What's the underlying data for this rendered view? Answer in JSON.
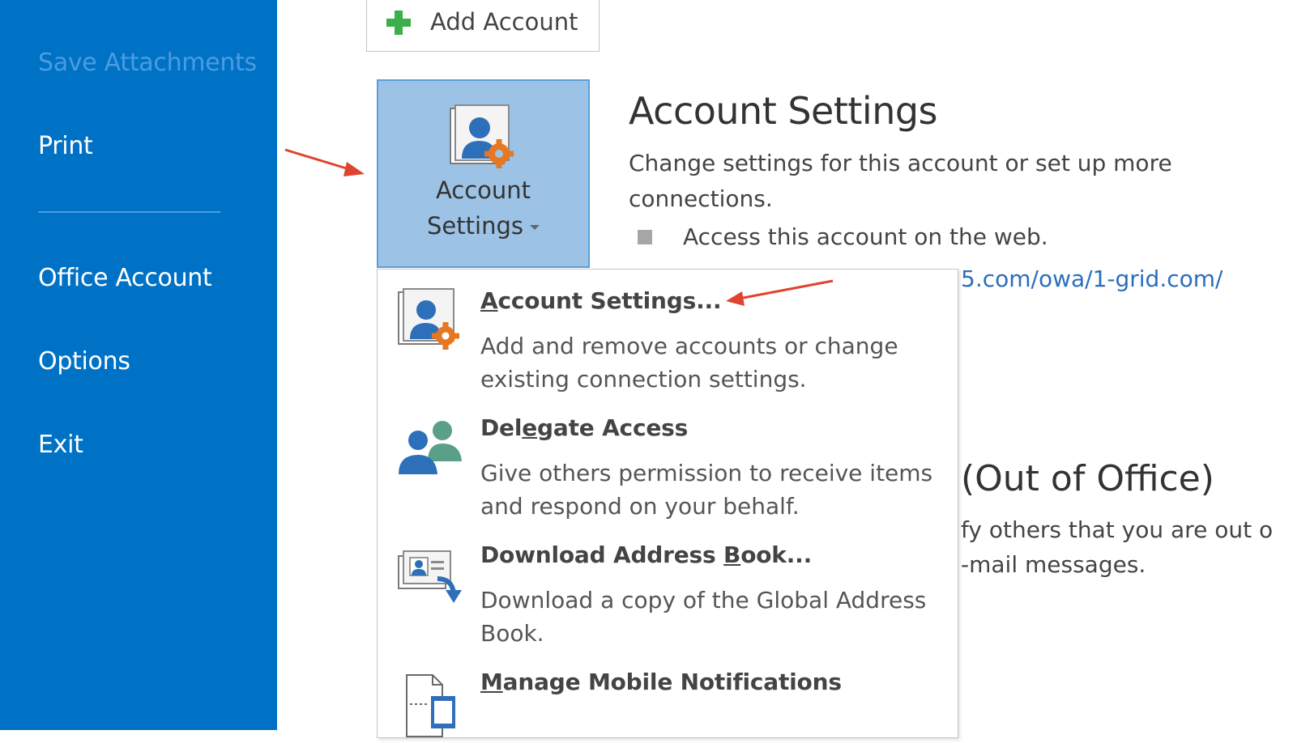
{
  "sidebar": {
    "items": [
      {
        "label": "Save Attachments"
      },
      {
        "label": "Print"
      },
      {
        "label": "Office Account"
      },
      {
        "label": "Options"
      },
      {
        "label": "Exit"
      }
    ]
  },
  "add_account": {
    "label": "Add Account",
    "icon": "plus-icon"
  },
  "account_settings_button": {
    "line1": "Account",
    "line2": "Settings",
    "icon": "account-settings-icon"
  },
  "account_section": {
    "title": "Account Settings",
    "description": "Change settings for this account or set up more connections.",
    "bullet": "Access this account on the web.",
    "link_fragment": "5.com/owa/1-grid.com/"
  },
  "auto_reply_section": {
    "title_fragment": "(Out of Office)",
    "desc_line1": "fy others that you are out o",
    "desc_line2": "-mail messages."
  },
  "dropdown": {
    "items": [
      {
        "title_underlined": "A",
        "title_rest": "ccount Settings...",
        "description": "Add and remove accounts or change existing connection settings.",
        "icon": "account-settings-icon"
      },
      {
        "title_pre": "Del",
        "title_underlined": "e",
        "title_rest": "gate Access",
        "description": "Give others permission to receive items and respond on your behalf.",
        "icon": "delegate-icon"
      },
      {
        "title_pre": "Download Address ",
        "title_underlined": "B",
        "title_rest": "ook...",
        "description": "Download a copy of the Global Address Book.",
        "icon": "address-book-download-icon"
      },
      {
        "title_underlined": "M",
        "title_rest": "anage Mobile Notifications",
        "icon": "mobile-notifications-icon"
      }
    ]
  },
  "colors": {
    "sidebar_bg": "#0072c6",
    "selected_button_bg": "#9cc3e5",
    "link": "#2a6ebb",
    "annotation_arrow": "#e0432f"
  }
}
